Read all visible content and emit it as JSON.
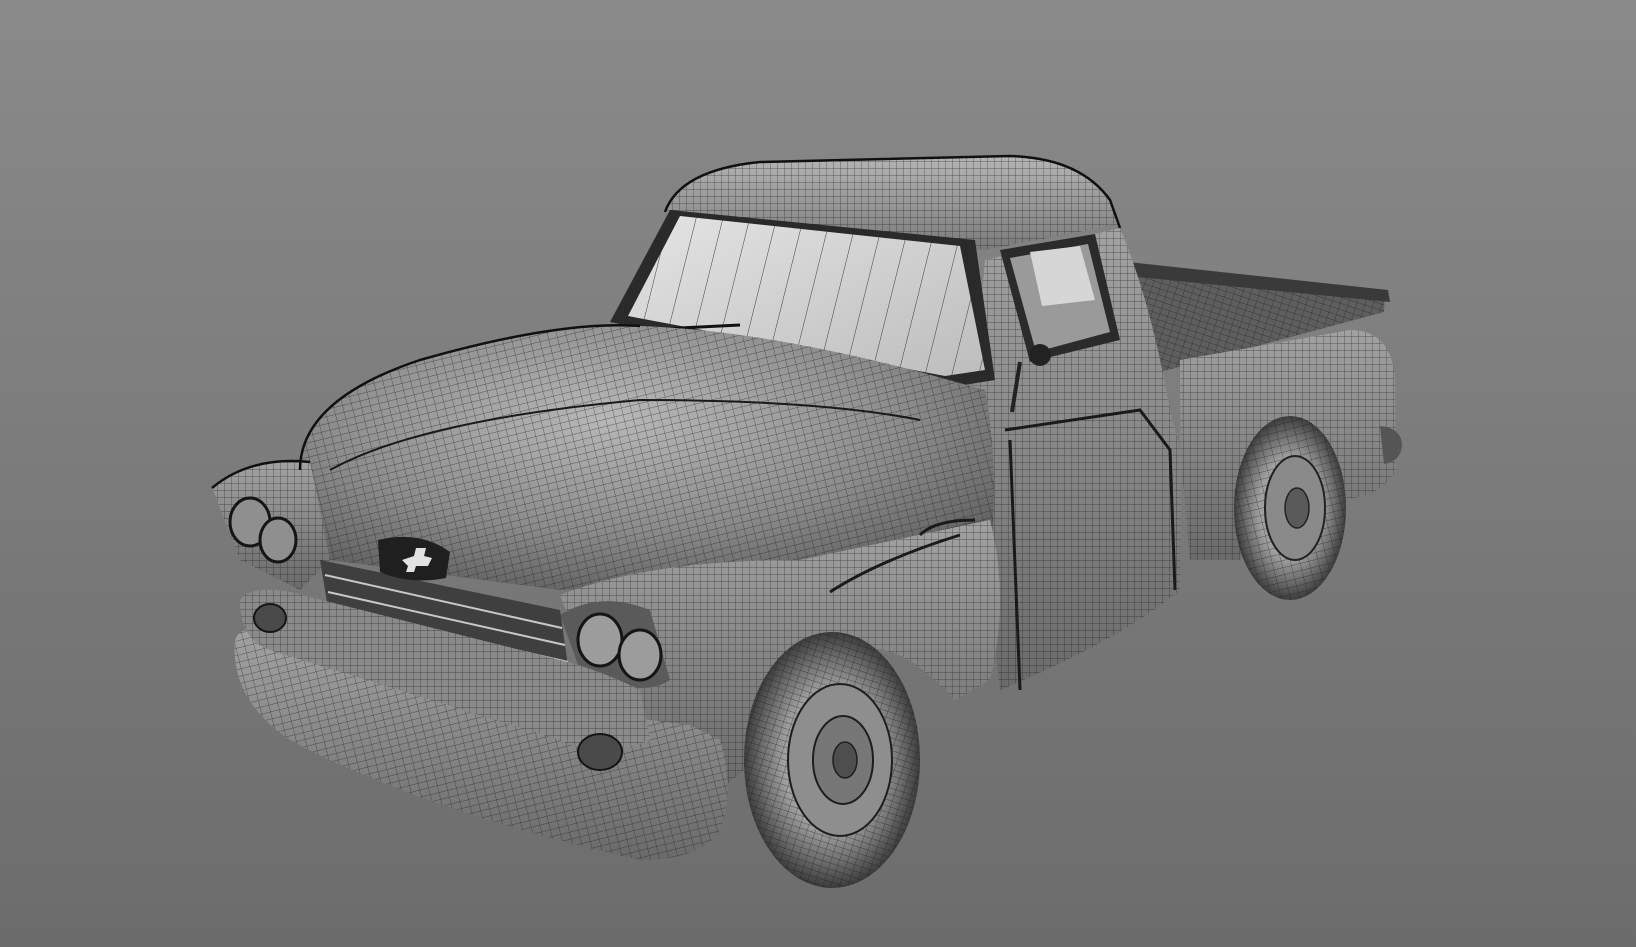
{
  "viewport": {
    "background_top": "#8a8a8a",
    "background_bottom": "#6c6c6c",
    "wire_color": "#1a1a1a",
    "surface_light": "#a9a9a9",
    "surface_mid": "#7c7c7c",
    "glass": "#d4d4d4"
  },
  "model": {
    "subject": "pickup-truck",
    "render_mode": "wireframe-on-shaded",
    "emblem_icon": "bowtie-icon"
  }
}
